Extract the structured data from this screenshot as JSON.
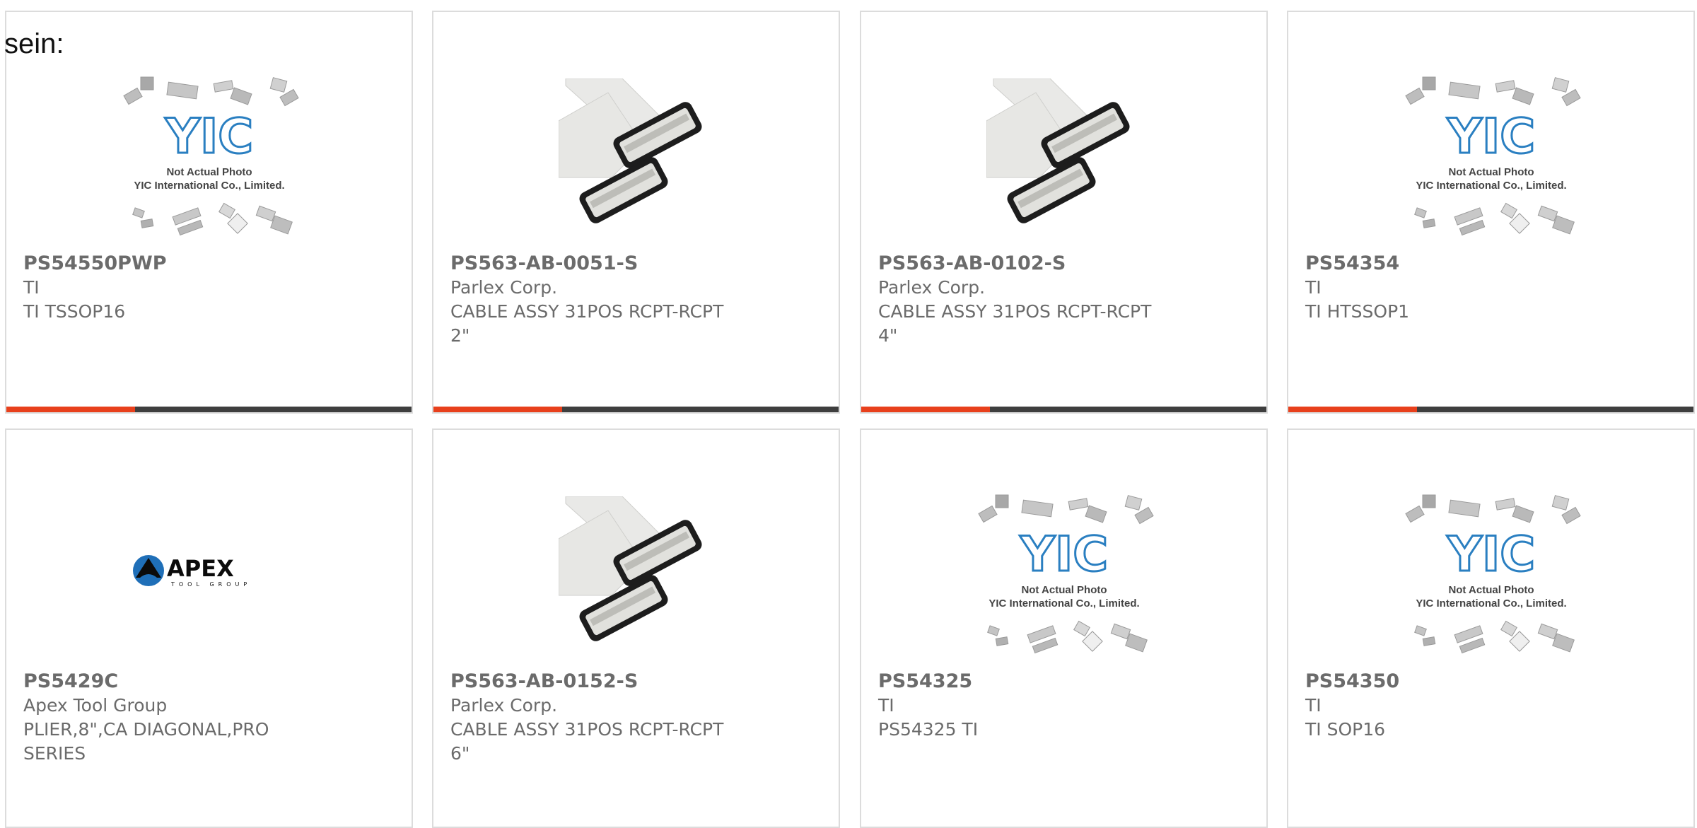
{
  "page": {
    "label": "sein:"
  },
  "colors": {
    "accent": "#e8401c",
    "bar": "#3e3e3e",
    "yic_blue": "#2a7fc1"
  },
  "products": [
    {
      "part": "PS54550PWP",
      "maker": "TI",
      "desc": "TI TSSOP16",
      "image": "yic-placeholder"
    },
    {
      "part": "PS563-AB-0051-S",
      "maker": "Parlex Corp.",
      "desc": "CABLE ASSY 31POS RCPT-RCPT 2\"",
      "image": "ribbon-cable"
    },
    {
      "part": "PS563-AB-0102-S",
      "maker": "Parlex Corp.",
      "desc": "CABLE ASSY 31POS RCPT-RCPT 4\"",
      "image": "ribbon-cable"
    },
    {
      "part": "PS54354",
      "maker": "TI",
      "desc": "TI HTSSOP1",
      "image": "yic-placeholder"
    },
    {
      "part": "PS5429C",
      "maker": "Apex Tool Group",
      "desc": "PLIER,8\",CA DIAGONAL,PRO SERIES",
      "image": "apex-logo"
    },
    {
      "part": "PS563-AB-0152-S",
      "maker": "Parlex Corp.",
      "desc": "CABLE ASSY 31POS RCPT-RCPT 6\"",
      "image": "ribbon-cable"
    },
    {
      "part": "PS54325",
      "maker": "TI",
      "desc": "PS54325 TI",
      "image": "yic-placeholder"
    },
    {
      "part": "PS54350",
      "maker": "TI",
      "desc": "TI SOP16",
      "image": "yic-placeholder"
    }
  ],
  "yic": {
    "logo_text": "YIC",
    "caption_line1": "Not Actual Photo",
    "caption_line2": "YIC International Co., Limited."
  },
  "apex": {
    "wordmark": "APEX",
    "subtext": "TOOL GROUP"
  }
}
